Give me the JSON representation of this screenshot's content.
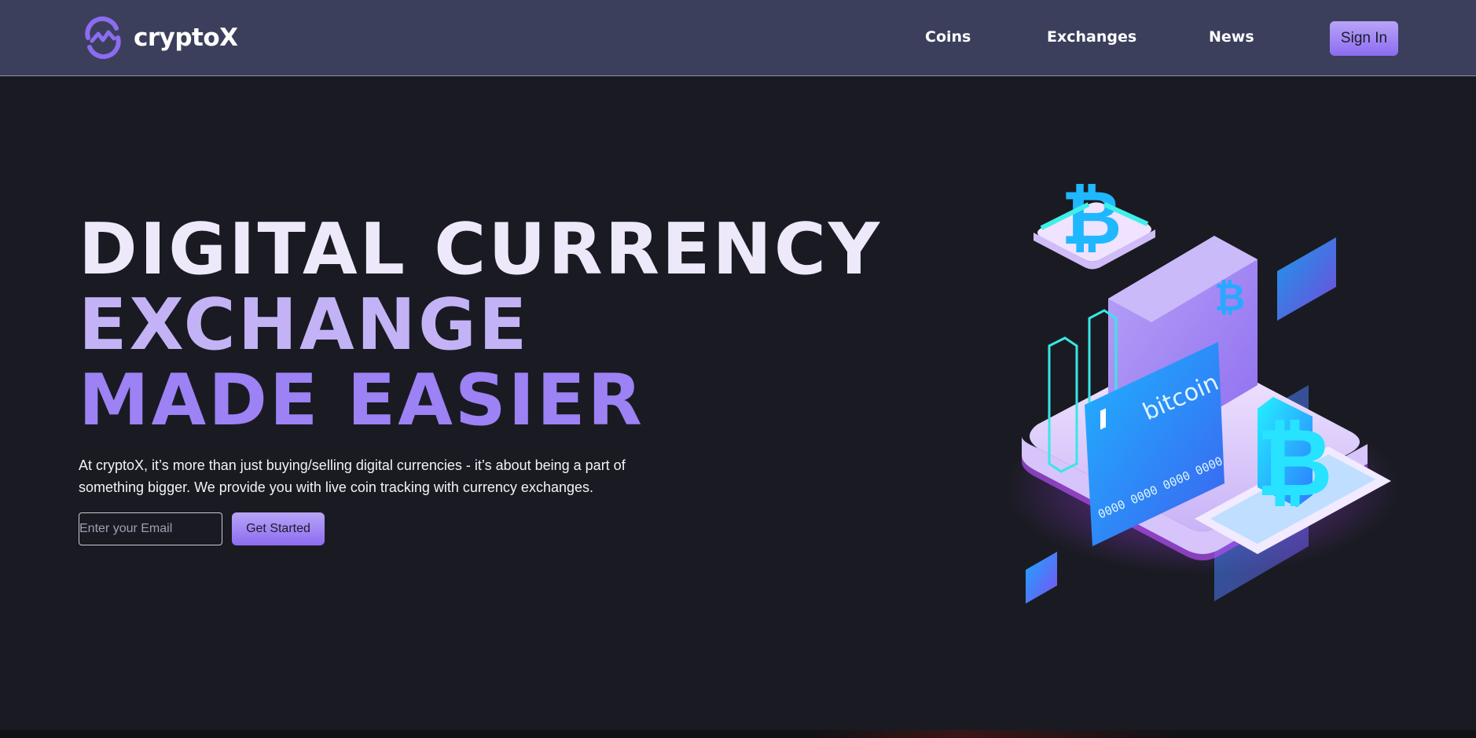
{
  "brand": {
    "name": "cryptoX",
    "icon": "chart-circle-icon",
    "accent": "#8c6cf0"
  },
  "nav": {
    "links": [
      {
        "label": "Coins"
      },
      {
        "label": "Exchanges"
      },
      {
        "label": "News"
      }
    ],
    "sign_in_label": "Sign In"
  },
  "hero": {
    "title_line1": "DIGITAL CURRENCY",
    "title_line2": "EXCHANGE",
    "title_line3": "MADE EASIER",
    "description": "At cryptoX, it’s more than just buying/selling digital currencies - it’s about being a part of something bigger. We provide you with live coin tracking with currency exchanges.",
    "email_placeholder": "Enter your Email",
    "cta_label": "Get Started"
  },
  "illustration": {
    "card_text": "bitcoin",
    "card_number": "0000 0000 0000 0000",
    "icon": "bitcoin-isometric-icon"
  },
  "colors": {
    "nav_bg": "#3b3f5c",
    "page_bg": "#1a1b22",
    "title_light": "#ede9fb",
    "title_mid": "#c3b3f6",
    "title_dark": "#9c82f4"
  }
}
